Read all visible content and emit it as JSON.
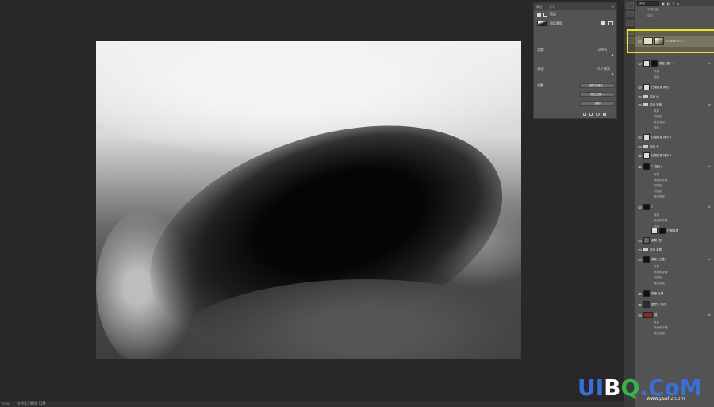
{
  "properties": {
    "tabs": [
      "属性",
      "学习"
    ],
    "kind_label": "图层",
    "layer_title": "图层蒙版",
    "density_label": "浓度:",
    "density_value": "100%",
    "feather_label": "羽化:",
    "feather_value": "0.0 像素",
    "adjust_label": "调整:",
    "btn_select_mask": "选择并遮住...",
    "btn_color_range": "颜色范围...",
    "btn_invert": "反相"
  },
  "layers_panel": {
    "search_placeholder": "类型",
    "filter_opacity": "不透明度:",
    "filter_fill": "填充:",
    "selected_layer": "YOSEMITE V...",
    "items": [
      {
        "name": "表盘 (圆) ...",
        "effects": [
          "效果",
          "投影"
        ]
      },
      {
        "name": "扫描纹理 拷贝"
      },
      {
        "name": "表盘 小"
      },
      {
        "name": "表盘 宝珠",
        "effects": [
          "效果",
          "内阴影",
          "渐变叠加",
          "投影"
        ]
      },
      {
        "name": "扫描纹理 拷贝 2"
      },
      {
        "name": "表盘 大"
      },
      {
        "name": "扫描纹理 拷贝 3"
      },
      {
        "name": "2 (指针)",
        "effects": [
          "效果",
          "斜面和浮雕",
          "内阴影",
          "内阴影",
          "渐变叠加"
        ]
      },
      {
        "name": "7",
        "effects": [
          "效果",
          "斜面和浮雕",
          "投影"
        ]
      },
      {
        "name": "扫描纹理"
      },
      {
        "name": "金属 (拉)"
      },
      {
        "name": "表盘 金属"
      },
      {
        "name": "表盘 (凹槽)",
        "effects": [
          "效果",
          "斜面和浮雕",
          "内阴影",
          "渐变叠加"
        ]
      },
      {
        "name": "表盘 凸槽"
      },
      {
        "name": "图层 3 拷贝"
      },
      {
        "name": "底",
        "effects": [
          "效果",
          "斜面和浮雕",
          "渐变叠加"
        ]
      }
    ]
  },
  "status": {
    "zoom": "50%",
    "doc_info": "文档:4.29M/1.52M"
  },
  "watermark": {
    "ui": "UI",
    "b": "B",
    "q": "Q",
    "com": ".CoM",
    "url": "www.psahz.com"
  },
  "colors": {
    "highlight": "#e8e62a",
    "panel": "#535353",
    "workspace": "#282828"
  }
}
